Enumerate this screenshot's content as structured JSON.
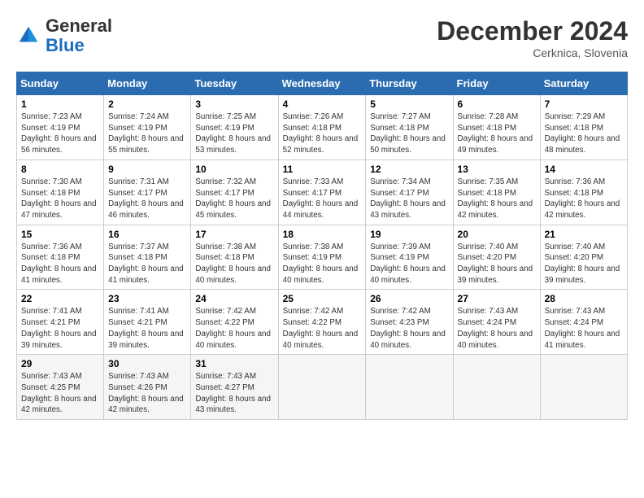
{
  "header": {
    "logo_general": "General",
    "logo_blue": "Blue",
    "month_title": "December 2024",
    "location": "Cerknica, Slovenia"
  },
  "weekdays": [
    "Sunday",
    "Monday",
    "Tuesday",
    "Wednesday",
    "Thursday",
    "Friday",
    "Saturday"
  ],
  "weeks": [
    [
      {
        "day": "1",
        "sunrise": "Sunrise: 7:23 AM",
        "sunset": "Sunset: 4:19 PM",
        "daylight": "Daylight: 8 hours and 56 minutes."
      },
      {
        "day": "2",
        "sunrise": "Sunrise: 7:24 AM",
        "sunset": "Sunset: 4:19 PM",
        "daylight": "Daylight: 8 hours and 55 minutes."
      },
      {
        "day": "3",
        "sunrise": "Sunrise: 7:25 AM",
        "sunset": "Sunset: 4:19 PM",
        "daylight": "Daylight: 8 hours and 53 minutes."
      },
      {
        "day": "4",
        "sunrise": "Sunrise: 7:26 AM",
        "sunset": "Sunset: 4:18 PM",
        "daylight": "Daylight: 8 hours and 52 minutes."
      },
      {
        "day": "5",
        "sunrise": "Sunrise: 7:27 AM",
        "sunset": "Sunset: 4:18 PM",
        "daylight": "Daylight: 8 hours and 50 minutes."
      },
      {
        "day": "6",
        "sunrise": "Sunrise: 7:28 AM",
        "sunset": "Sunset: 4:18 PM",
        "daylight": "Daylight: 8 hours and 49 minutes."
      },
      {
        "day": "7",
        "sunrise": "Sunrise: 7:29 AM",
        "sunset": "Sunset: 4:18 PM",
        "daylight": "Daylight: 8 hours and 48 minutes."
      }
    ],
    [
      {
        "day": "8",
        "sunrise": "Sunrise: 7:30 AM",
        "sunset": "Sunset: 4:18 PM",
        "daylight": "Daylight: 8 hours and 47 minutes."
      },
      {
        "day": "9",
        "sunrise": "Sunrise: 7:31 AM",
        "sunset": "Sunset: 4:17 PM",
        "daylight": "Daylight: 8 hours and 46 minutes."
      },
      {
        "day": "10",
        "sunrise": "Sunrise: 7:32 AM",
        "sunset": "Sunset: 4:17 PM",
        "daylight": "Daylight: 8 hours and 45 minutes."
      },
      {
        "day": "11",
        "sunrise": "Sunrise: 7:33 AM",
        "sunset": "Sunset: 4:17 PM",
        "daylight": "Daylight: 8 hours and 44 minutes."
      },
      {
        "day": "12",
        "sunrise": "Sunrise: 7:34 AM",
        "sunset": "Sunset: 4:17 PM",
        "daylight": "Daylight: 8 hours and 43 minutes."
      },
      {
        "day": "13",
        "sunrise": "Sunrise: 7:35 AM",
        "sunset": "Sunset: 4:18 PM",
        "daylight": "Daylight: 8 hours and 42 minutes."
      },
      {
        "day": "14",
        "sunrise": "Sunrise: 7:36 AM",
        "sunset": "Sunset: 4:18 PM",
        "daylight": "Daylight: 8 hours and 42 minutes."
      }
    ],
    [
      {
        "day": "15",
        "sunrise": "Sunrise: 7:36 AM",
        "sunset": "Sunset: 4:18 PM",
        "daylight": "Daylight: 8 hours and 41 minutes."
      },
      {
        "day": "16",
        "sunrise": "Sunrise: 7:37 AM",
        "sunset": "Sunset: 4:18 PM",
        "daylight": "Daylight: 8 hours and 41 minutes."
      },
      {
        "day": "17",
        "sunrise": "Sunrise: 7:38 AM",
        "sunset": "Sunset: 4:18 PM",
        "daylight": "Daylight: 8 hours and 40 minutes."
      },
      {
        "day": "18",
        "sunrise": "Sunrise: 7:38 AM",
        "sunset": "Sunset: 4:19 PM",
        "daylight": "Daylight: 8 hours and 40 minutes."
      },
      {
        "day": "19",
        "sunrise": "Sunrise: 7:39 AM",
        "sunset": "Sunset: 4:19 PM",
        "daylight": "Daylight: 8 hours and 40 minutes."
      },
      {
        "day": "20",
        "sunrise": "Sunrise: 7:40 AM",
        "sunset": "Sunset: 4:20 PM",
        "daylight": "Daylight: 8 hours and 39 minutes."
      },
      {
        "day": "21",
        "sunrise": "Sunrise: 7:40 AM",
        "sunset": "Sunset: 4:20 PM",
        "daylight": "Daylight: 8 hours and 39 minutes."
      }
    ],
    [
      {
        "day": "22",
        "sunrise": "Sunrise: 7:41 AM",
        "sunset": "Sunset: 4:21 PM",
        "daylight": "Daylight: 8 hours and 39 minutes."
      },
      {
        "day": "23",
        "sunrise": "Sunrise: 7:41 AM",
        "sunset": "Sunset: 4:21 PM",
        "daylight": "Daylight: 8 hours and 39 minutes."
      },
      {
        "day": "24",
        "sunrise": "Sunrise: 7:42 AM",
        "sunset": "Sunset: 4:22 PM",
        "daylight": "Daylight: 8 hours and 40 minutes."
      },
      {
        "day": "25",
        "sunrise": "Sunrise: 7:42 AM",
        "sunset": "Sunset: 4:22 PM",
        "daylight": "Daylight: 8 hours and 40 minutes."
      },
      {
        "day": "26",
        "sunrise": "Sunrise: 7:42 AM",
        "sunset": "Sunset: 4:23 PM",
        "daylight": "Daylight: 8 hours and 40 minutes."
      },
      {
        "day": "27",
        "sunrise": "Sunrise: 7:43 AM",
        "sunset": "Sunset: 4:24 PM",
        "daylight": "Daylight: 8 hours and 40 minutes."
      },
      {
        "day": "28",
        "sunrise": "Sunrise: 7:43 AM",
        "sunset": "Sunset: 4:24 PM",
        "daylight": "Daylight: 8 hours and 41 minutes."
      }
    ],
    [
      {
        "day": "29",
        "sunrise": "Sunrise: 7:43 AM",
        "sunset": "Sunset: 4:25 PM",
        "daylight": "Daylight: 8 hours and 42 minutes."
      },
      {
        "day": "30",
        "sunrise": "Sunrise: 7:43 AM",
        "sunset": "Sunset: 4:26 PM",
        "daylight": "Daylight: 8 hours and 42 minutes."
      },
      {
        "day": "31",
        "sunrise": "Sunrise: 7:43 AM",
        "sunset": "Sunset: 4:27 PM",
        "daylight": "Daylight: 8 hours and 43 minutes."
      },
      null,
      null,
      null,
      null
    ]
  ]
}
